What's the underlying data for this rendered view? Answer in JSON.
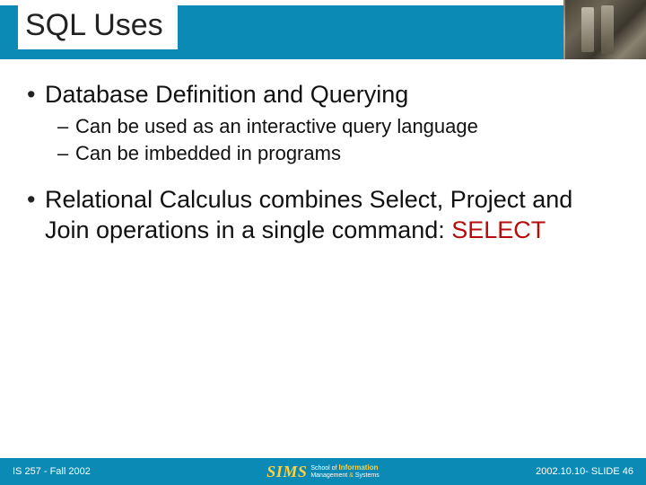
{
  "title": "SQL Uses",
  "bullets": {
    "b1": "Database Definition and Querying",
    "b1a": "Can be used as an interactive query language",
    "b1b": "Can be imbedded in programs",
    "b2_pre": "Relational Calculus combines Select, Project and Join operations in a single command: ",
    "b2_kw": "SELECT"
  },
  "footer": {
    "left": "IS 257 - Fall 2002",
    "right": "2002.10.10- SLIDE 46",
    "logo": "SIMS",
    "sub_top": "School of",
    "sub_info": "Information",
    "sub_mgmt": "Management",
    "sub_amp": "&",
    "sub_sys": "Systems"
  }
}
